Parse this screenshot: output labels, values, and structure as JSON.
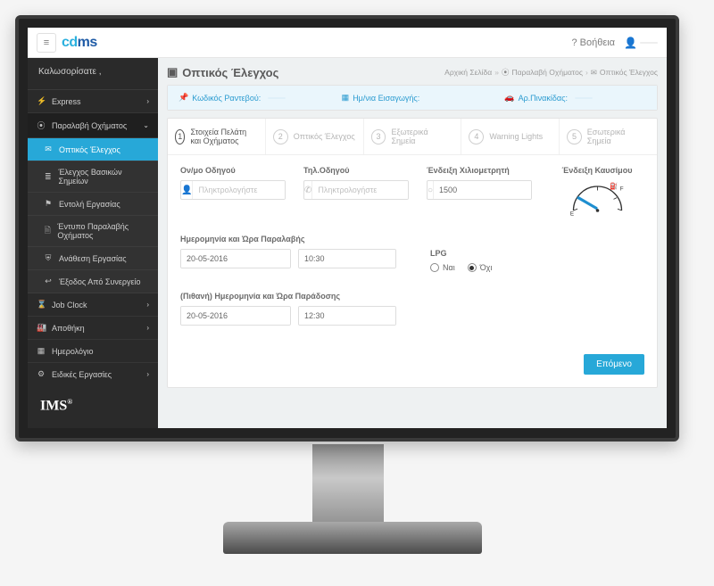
{
  "topbar": {
    "help_label": "Βοήθεια"
  },
  "sidebar": {
    "welcome": "Καλωσορίσατε ,",
    "items": [
      {
        "icon": "⚡",
        "label": "Express",
        "chev": "›"
      },
      {
        "icon": "⦿",
        "label": "Παραλαβή Οχήματος",
        "chev": "⌄",
        "group": true,
        "subs": [
          {
            "icon": "✉",
            "label": "Οπτικός Έλεγχος",
            "active": true
          },
          {
            "icon": "≣",
            "label": "Έλεγχος Βασικών Σημείων"
          },
          {
            "icon": "⚑",
            "label": "Εντολή Εργασίας"
          },
          {
            "icon": "🗎",
            "label": "Έντυπο Παραλαβής Οχήματος"
          },
          {
            "icon": "⛨",
            "label": "Ανάθεση Εργασίας"
          },
          {
            "icon": "↩",
            "label": "Έξοδος Από Συνεργείο"
          }
        ]
      },
      {
        "icon": "⌛",
        "label": "Job Clock",
        "chev": "›"
      },
      {
        "icon": "🏭",
        "label": "Αποθήκη",
        "chev": "›"
      },
      {
        "icon": "▦",
        "label": "Ημερολόγιο"
      },
      {
        "icon": "⚙",
        "label": "Ειδικές Εργασίες",
        "chev": "›"
      }
    ],
    "footer": "IMS"
  },
  "page": {
    "title": "Οπτικός Έλεγχος",
    "crumbs": [
      "Αρχική Σελίδα",
      "Παραλαβή Οχήματος",
      "Οπτικός Έλεγχος"
    ]
  },
  "info_strip": [
    {
      "icon": "📌",
      "label": "Κωδικός Ραντεβού:",
      "val": ""
    },
    {
      "icon": "▦",
      "label": "Ημ/νια Εισαγωγής:",
      "val": ""
    },
    {
      "icon": "🚗",
      "label": "Αρ.Πινακίδας:",
      "val": ""
    }
  ],
  "steps": [
    {
      "num": "1",
      "label": "Στοιχεία Πελάτη και Οχήματος"
    },
    {
      "num": "2",
      "label": "Οπτικός Έλεγχος"
    },
    {
      "num": "3",
      "label": "Εξωτερικά Σημεία"
    },
    {
      "num": "4",
      "label": "Warning Lights"
    },
    {
      "num": "5",
      "label": "Εσωτερικά Σημεία"
    }
  ],
  "form": {
    "driver_name_label": "Ον/μο Οδηγού",
    "driver_name_ph": "Πληκτρολογήστε",
    "driver_phone_label": "Τηλ.Οδηγού",
    "driver_phone_ph": "Πληκτρολογήστε",
    "odo_label": "Ένδειξη Χιλιομετρητή",
    "odo_value": "1500",
    "fuel_label": "Ένδειξη Καυσίμου",
    "fuel_e": "E",
    "fuel_f": "F",
    "recv_label": "Ημερομηνία και Ώρα Παραλαβής",
    "recv_date": "20-05-2016",
    "recv_time": "10:30",
    "delv_label": "(Πιθανή) Ημερομηνία και Ώρα Παράδοσης",
    "delv_date": "20-05-2016",
    "delv_time": "12:30",
    "lpg_label": "LPG",
    "lpg_yes": "Ναι",
    "lpg_no": "Όχι",
    "lpg_selected": "no",
    "next_btn": "Επόμενο"
  }
}
